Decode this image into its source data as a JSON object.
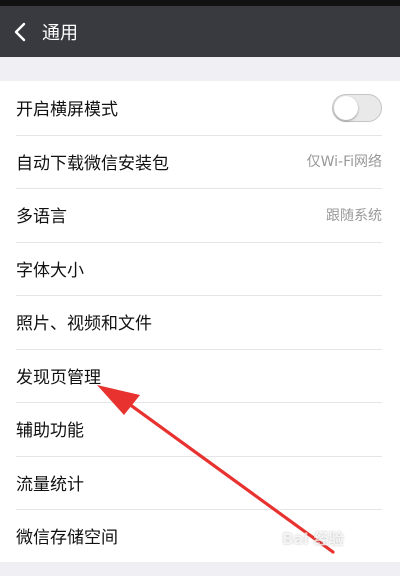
{
  "header": {
    "title": "通用",
    "back_icon": "chevron-left-icon",
    "background": "#393a3f"
  },
  "settings": {
    "items": [
      {
        "label": "开启横屏模式",
        "type": "toggle",
        "toggle_on": false
      },
      {
        "label": "自动下载微信安装包",
        "type": "value",
        "value": "仅Wi-Fi网络"
      },
      {
        "label": "多语言",
        "type": "value",
        "value": "跟随系统"
      },
      {
        "label": "字体大小",
        "type": "link"
      },
      {
        "label": "照片、视频和文件",
        "type": "link"
      },
      {
        "label": "发现页管理",
        "type": "link",
        "highlighted_by_arrow": true
      },
      {
        "label": "辅助功能",
        "type": "link"
      },
      {
        "label": "流量统计",
        "type": "link"
      },
      {
        "label": "微信存储空间",
        "type": "link"
      }
    ]
  },
  "annotation": {
    "arrow_color": "#e8322f",
    "points_to": "发现页管理"
  },
  "watermark": {
    "text": "Bai 经验"
  }
}
